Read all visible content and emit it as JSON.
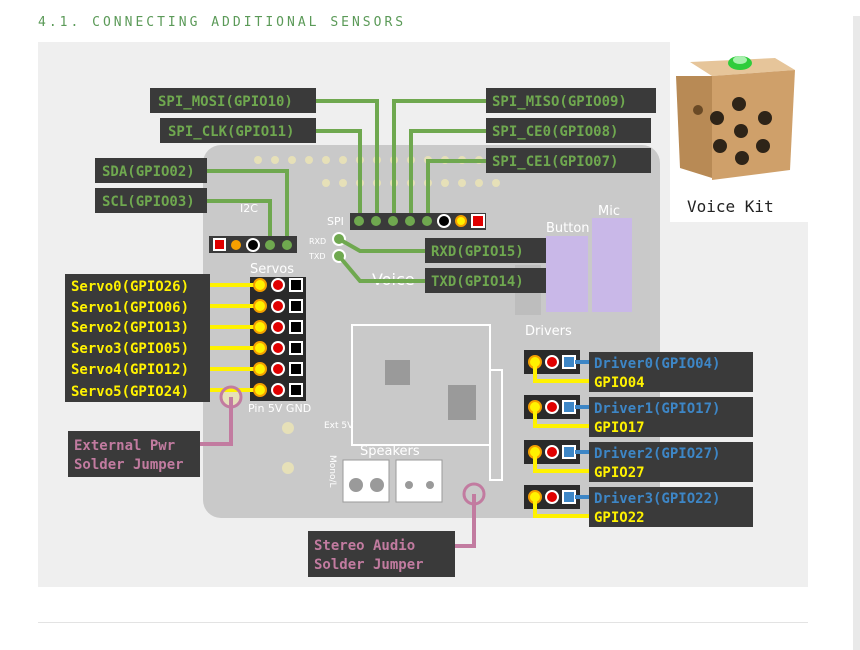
{
  "heading": "4.1. CONNECTING ADDITIONAL SENSORS",
  "kit_caption": "Voice Kit",
  "colors": {
    "green": "#6fa84f",
    "yellow": "#fff200",
    "blue": "#3d86c6",
    "pink": "#c27ba0",
    "label_bg": "#3a3a3a",
    "board": "#c9c9c9"
  },
  "board_labels": {
    "i2c": "I2C",
    "spi": "SPI",
    "servos": "Servos",
    "drivers": "Drivers",
    "speakers": "Speakers",
    "button": "Button",
    "mic": "Mic",
    "pin_5v_gnd": "Pin 5V GND",
    "voice": "Voice",
    "rxd": "RXD",
    "txd": "TXD",
    "ext_5v": "Ext 5V",
    "mono": "Mono/L"
  },
  "spi_labels": [
    "SPI_MOSI(GPIO10)",
    "SPI_CLK(GPIO11)",
    "SPI_MISO(GPIO09)",
    "SPI_CE0(GPIO08)",
    "SPI_CE1(GPIO07)"
  ],
  "i2c_labels": [
    "SDA(GPIO02)",
    "SCL(GPIO03)"
  ],
  "uart_labels": [
    "RXD(GPIO15)",
    "TXD(GPIO14)"
  ],
  "servo_labels": [
    "Servo0(GPIO26)",
    "Servo1(GPIO06)",
    "Servo2(GPIO13)",
    "Servo3(GPIO05)",
    "Servo4(GPIO12)",
    "Servo5(GPIO24)"
  ],
  "drivers": [
    {
      "name": "Driver0(GPIO04)",
      "gpio": "GPIO04"
    },
    {
      "name": "Driver1(GPIO17)",
      "gpio": "GPIO17"
    },
    {
      "name": "Driver2(GPIO27)",
      "gpio": "GPIO27"
    },
    {
      "name": "Driver3(GPIO22)",
      "gpio": "GPIO22"
    }
  ],
  "jumpers": {
    "ext_pwr_line1": "External Pwr",
    "ext_pwr_line2": "Solder Jumper",
    "stereo_line1": "Stereo Audio",
    "stereo_line2": "Solder Jumper"
  }
}
